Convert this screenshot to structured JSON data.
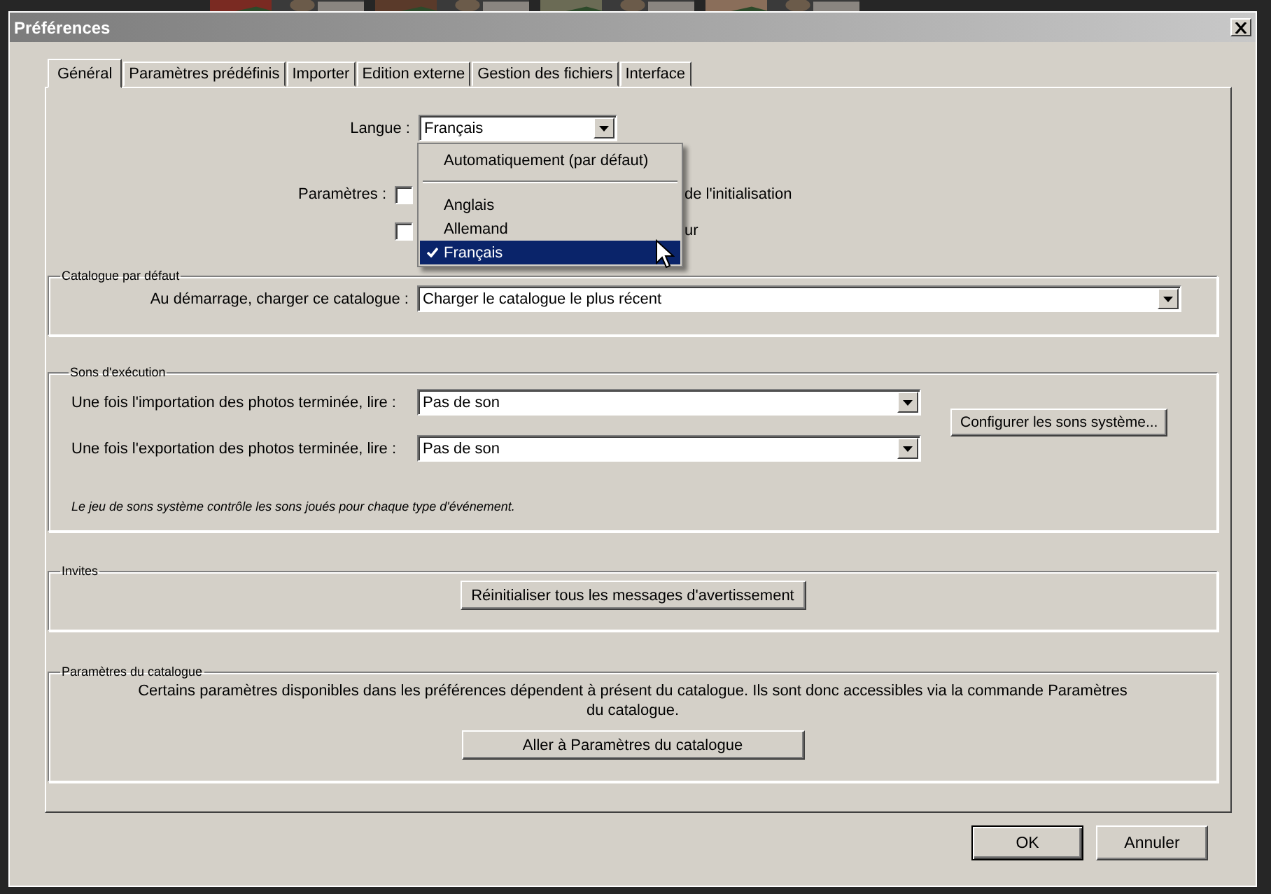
{
  "window": {
    "title": "Préférences"
  },
  "tabs": [
    {
      "label": "Général",
      "selected": true
    },
    {
      "label": "Paramètres prédéfinis",
      "selected": false
    },
    {
      "label": "Importer",
      "selected": false
    },
    {
      "label": "Edition externe",
      "selected": false
    },
    {
      "label": "Gestion des fichiers",
      "selected": false
    },
    {
      "label": "Interface",
      "selected": false
    }
  ],
  "language": {
    "label": "Langue :",
    "value": "Français",
    "menu": {
      "groups": [
        [
          {
            "label": "Automatiquement (par défaut)",
            "selected": false
          }
        ],
        [
          {
            "label": "Anglais",
            "selected": false
          },
          {
            "label": "Allemand",
            "selected": false
          },
          {
            "label": "Français",
            "selected": true
          }
        ]
      ]
    }
  },
  "settings": {
    "label": "Paramètres :",
    "checkboxes": [
      {
        "label": "de l'initialisation",
        "checked": false
      },
      {
        "label": "ur",
        "checked": false
      }
    ]
  },
  "default_catalog": {
    "title": "Catalogue par défaut",
    "label": "Au démarrage, charger ce catalogue :",
    "value": "Charger le catalogue le plus récent"
  },
  "sounds": {
    "title": "Sons d'exécution",
    "rows": [
      {
        "label": "Une fois l'importation des photos terminée, lire :",
        "value": "Pas de son"
      },
      {
        "label": "Une fois l'exportation des photos terminée, lire :",
        "value": "Pas de son"
      }
    ],
    "button": "Configurer les sons système...",
    "note": "Le jeu de sons système contrôle les sons joués pour chaque type d'événement."
  },
  "prompts": {
    "title": "Invites",
    "button": "Réinitialiser tous les messages d'avertissement"
  },
  "catalog_settings": {
    "title": "Paramètres du catalogue",
    "text": "Certains paramètres disponibles dans les préférences dépendent à présent du catalogue. Ils sont donc accessibles via la commande Paramètres du catalogue.",
    "button": "Aller à Paramètres du catalogue"
  },
  "buttons": [
    "OK",
    "Annuler"
  ]
}
